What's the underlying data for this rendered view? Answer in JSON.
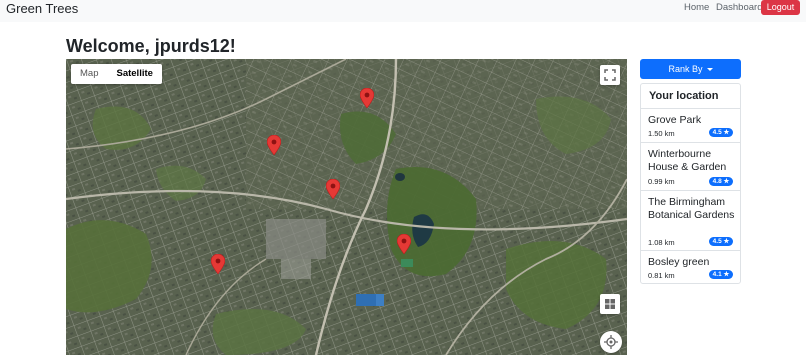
{
  "navbar": {
    "brand": "Green Trees",
    "home": "Home",
    "dashboard": "Dashboard",
    "logout": "Logout",
    "colors": {
      "background": "#f8f9fa",
      "logout": "#dc3545"
    }
  },
  "heading": "Welcome, jpurds12!",
  "map": {
    "toggle": {
      "map": "Map",
      "satellite": "Satellite",
      "selected": "Satellite"
    },
    "icons": [
      "fullscreen-icon",
      "layers-icon",
      "locate-icon",
      "map-pin-icon"
    ],
    "pin_color": "#e53935"
  },
  "rank": {
    "label": "Rank By",
    "color": "#0d6efd"
  },
  "list": {
    "title": "Your location",
    "items": [
      {
        "name": "Grove Park",
        "distance": "1.50 km",
        "rating": "4.5 ★"
      },
      {
        "name": "Winterbourne House & Garden",
        "distance": "0.99 km",
        "rating": "4.8 ★"
      },
      {
        "name": "The Birmingham Botanical Gardens",
        "distance": "1.08 km",
        "rating": "4.5 ★"
      },
      {
        "name": "Bosley green",
        "distance": "0.81 km",
        "rating": "4.1 ★"
      }
    ]
  }
}
